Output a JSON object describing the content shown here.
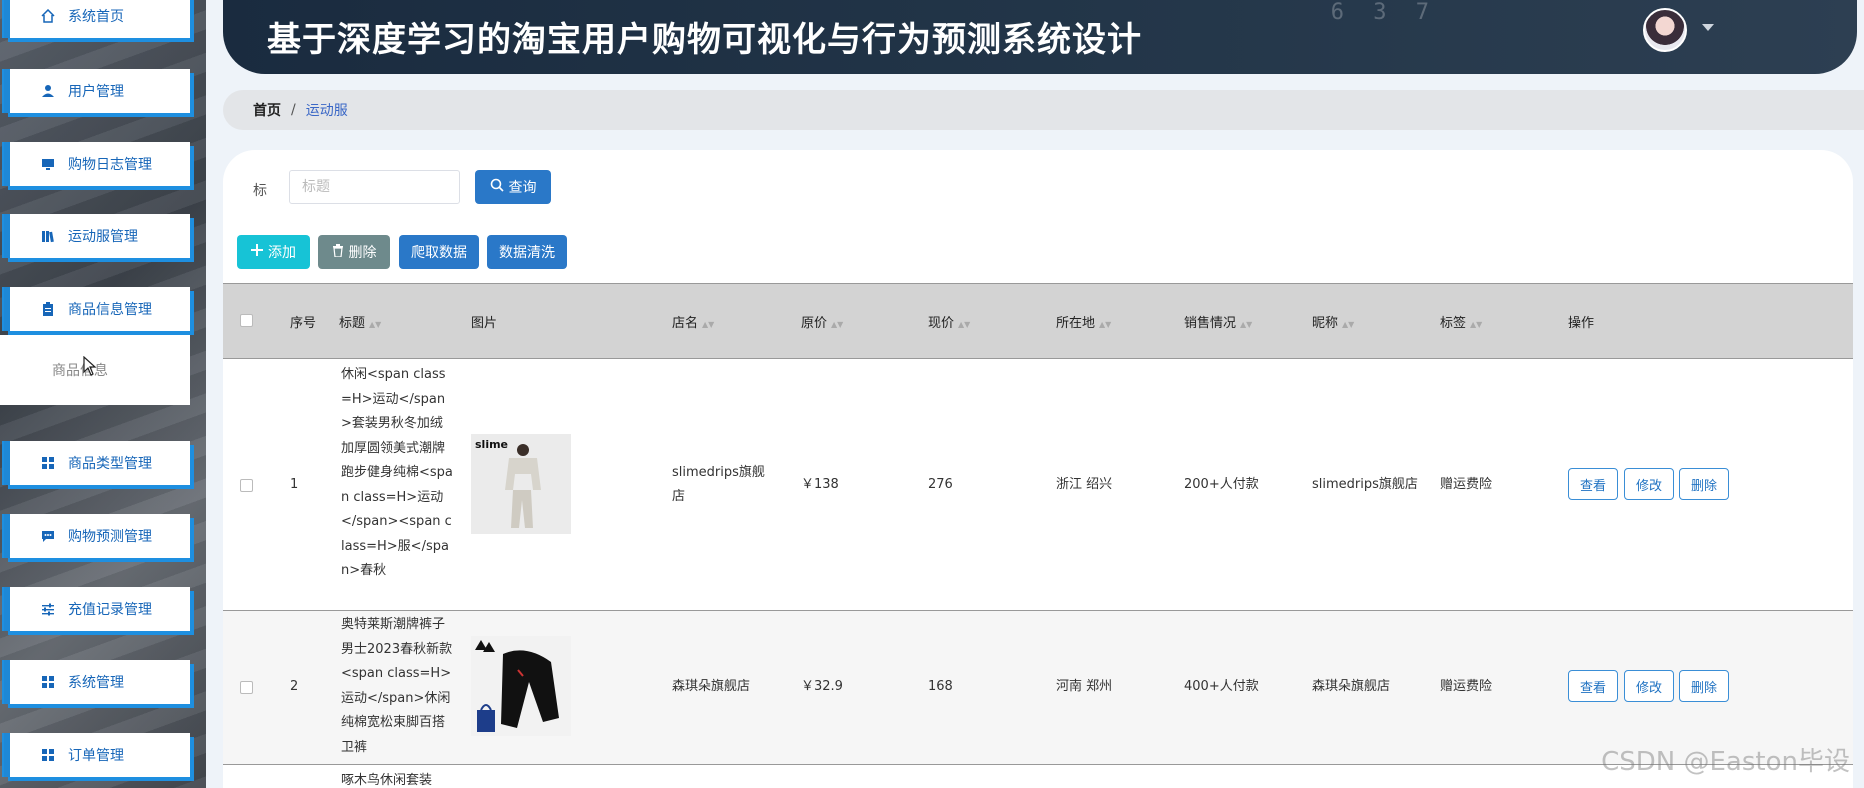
{
  "sidebar": {
    "items": [
      {
        "label": "系统首页",
        "icon": "home-icon"
      },
      {
        "label": "用户管理",
        "icon": "user-icon"
      },
      {
        "label": "购物日志管理",
        "icon": "monitor-icon"
      },
      {
        "label": "运动服管理",
        "icon": "library-icon"
      },
      {
        "label": "商品信息管理",
        "icon": "clipboard-icon"
      },
      {
        "label": "商品类型管理",
        "icon": "grid-icon"
      },
      {
        "label": "购物预测管理",
        "icon": "chat-icon"
      },
      {
        "label": "充值记录管理",
        "icon": "sliders-icon"
      },
      {
        "label": "系统管理",
        "icon": "grid-icon"
      },
      {
        "label": "订单管理",
        "icon": "grid-icon"
      }
    ],
    "submenu": {
      "label": "商品信息"
    }
  },
  "header": {
    "title": "基于深度学习的淘宝用户购物可视化与行为预测系统设计",
    "deco": "6 3 7"
  },
  "breadcrumb": {
    "home": "首页",
    "separator": "/",
    "current": "运动服"
  },
  "search": {
    "label": "标",
    "placeholder": "标题",
    "button": "查询"
  },
  "toolbar": {
    "add": "添加",
    "delete": "删除",
    "crawl": "爬取数据",
    "clean": "数据清洗"
  },
  "table": {
    "headers": {
      "index": "序号",
      "title": "标题",
      "image": "图片",
      "shop": "店名",
      "original_price": "原价",
      "current_price": "现价",
      "location": "所在地",
      "sales": "销售情况",
      "nickname": "昵称",
      "tag": "标签",
      "actions": "操作"
    },
    "rows": [
      {
        "index": "1",
        "title": "休闲<span class=H>运动</span>套装男秋冬加绒加厚圆领美式潮牌跑步健身纯棉<span class=H>运动</span><span class=H>服</span>春秋",
        "shop": "slimedrips旗舰店",
        "original_price": "￥138",
        "current_price": "276",
        "location": "浙江 绍兴",
        "sales": "200+人付款",
        "nickname": "slimedrips旗舰店",
        "tag": "赠运费险"
      },
      {
        "index": "2",
        "title": "奥特莱斯潮牌裤子男士2023春秋新款<span class=H>运动</span>休闲纯棉宽松束脚百搭卫裤",
        "shop": "森琪朵旗舰店",
        "original_price": "￥32.9",
        "current_price": "168",
        "location": "河南 郑州",
        "sales": "400+人付款",
        "nickname": "森琪朵旗舰店",
        "tag": "赠运费险"
      },
      {
        "index": "",
        "title": "啄木鸟休闲套装"
      }
    ],
    "ops": {
      "view": "查看",
      "edit": "修改",
      "delete": "删除"
    }
  },
  "watermark": "CSDN @Easton毕设",
  "colors": {
    "accent": "#2a78c8",
    "add": "#17c3d6",
    "delete": "#6e8a8c",
    "header_bg": "#1a2b3f"
  }
}
